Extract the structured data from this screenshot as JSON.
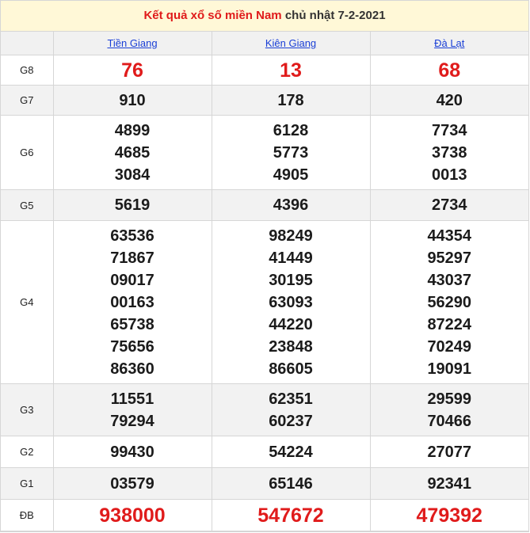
{
  "title": {
    "prefix": "Kết quả xổ số miền Nam",
    "suffix": "chủ nhật 7-2-2021"
  },
  "provinces": [
    "Tiền Giang",
    "Kiên Giang",
    "Đà Lạt"
  ],
  "rows": [
    {
      "label": "G8",
      "values": [
        [
          "76"
        ],
        [
          "13"
        ],
        [
          "68"
        ]
      ]
    },
    {
      "label": "G7",
      "values": [
        [
          "910"
        ],
        [
          "178"
        ],
        [
          "420"
        ]
      ]
    },
    {
      "label": "G6",
      "values": [
        [
          "4899",
          "4685",
          "3084"
        ],
        [
          "6128",
          "5773",
          "4905"
        ],
        [
          "7734",
          "3738",
          "0013"
        ]
      ]
    },
    {
      "label": "G5",
      "values": [
        [
          "5619"
        ],
        [
          "4396"
        ],
        [
          "2734"
        ]
      ]
    },
    {
      "label": "G4",
      "values": [
        [
          "63536",
          "71867",
          "09017",
          "00163",
          "65738",
          "75656",
          "86360"
        ],
        [
          "98249",
          "41449",
          "30195",
          "63093",
          "44220",
          "23848",
          "86605"
        ],
        [
          "44354",
          "95297",
          "43037",
          "56290",
          "87224",
          "70249",
          "19091"
        ]
      ]
    },
    {
      "label": "G3",
      "values": [
        [
          "11551",
          "79294"
        ],
        [
          "62351",
          "60237"
        ],
        [
          "29599",
          "70466"
        ]
      ]
    },
    {
      "label": "G2",
      "values": [
        [
          "99430"
        ],
        [
          "54224"
        ],
        [
          "27077"
        ]
      ]
    },
    {
      "label": "G1",
      "values": [
        [
          "03579"
        ],
        [
          "65146"
        ],
        [
          "92341"
        ]
      ]
    },
    {
      "label": "ĐB",
      "values": [
        [
          "938000"
        ],
        [
          "547672"
        ],
        [
          "479392"
        ]
      ]
    }
  ]
}
